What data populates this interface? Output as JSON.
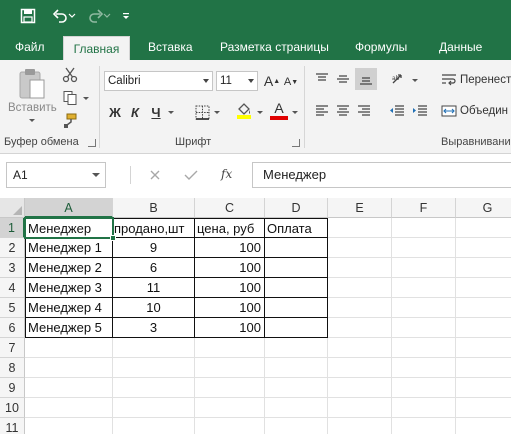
{
  "colors": {
    "brand": "#217346",
    "ribbon_bg": "#f3f3f3",
    "font_underline": "#e00000",
    "highlight": "#ffff00"
  },
  "qat": {
    "icons": [
      "save-icon",
      "undo-icon",
      "redo-icon",
      "customize-qat-icon"
    ]
  },
  "tabs": [
    {
      "label": "Файл",
      "active": false
    },
    {
      "label": "Главная",
      "active": true
    },
    {
      "label": "Вставка",
      "active": false
    },
    {
      "label": "Разметка страницы",
      "active": false
    },
    {
      "label": "Формулы",
      "active": false
    },
    {
      "label": "Данные",
      "active": false
    }
  ],
  "ribbon": {
    "clipboard": {
      "paste_label": "Вставить",
      "group_label": "Буфер обмена"
    },
    "font": {
      "name": "Calibri",
      "size": "11",
      "bold": "Ж",
      "italic": "К",
      "underline": "Ч",
      "font_color_letter": "A",
      "group_label": "Шрифт"
    },
    "alignment": {
      "wrap_label": "Перенест",
      "merge_label": "Объедин",
      "group_label": "Выравнивани"
    }
  },
  "formula_bar": {
    "name_box": "A1",
    "fx_label": "fx",
    "content": "Менеджер"
  },
  "sheet": {
    "columns": [
      "A",
      "B",
      "C",
      "D",
      "E",
      "F",
      "G"
    ],
    "rows": [
      "1",
      "2",
      "3",
      "4",
      "5",
      "6",
      "7",
      "8",
      "9",
      "10",
      "11"
    ],
    "active_cell": "A1",
    "cells": [
      [
        "Менеджер",
        "продано,шт",
        "цена, руб",
        "Оплата"
      ],
      [
        "Менеджер 1",
        "9",
        "100",
        ""
      ],
      [
        "Менеджер 2",
        "6",
        "100",
        ""
      ],
      [
        "Менеджер 3",
        "11",
        "100",
        ""
      ],
      [
        "Менеджер 4",
        "10",
        "100",
        ""
      ],
      [
        "Менеджер 5",
        "3",
        "100",
        ""
      ]
    ]
  }
}
